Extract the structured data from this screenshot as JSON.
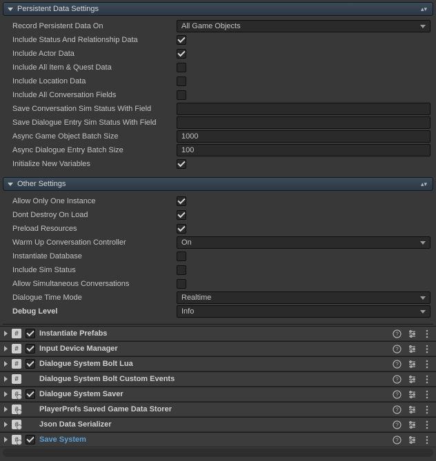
{
  "section1": {
    "title": "Persistent Data Settings",
    "rows": {
      "record_on": {
        "label": "Record Persistent Data On",
        "dropdown": "All Game Objects"
      },
      "inc_status_rel": {
        "label": "Include Status And Relationship Data",
        "checked": true
      },
      "inc_actor": {
        "label": "Include Actor Data",
        "checked": true
      },
      "inc_item_quest": {
        "label": "Include All Item & Quest Data",
        "checked": false
      },
      "inc_location": {
        "label": "Include Location Data",
        "checked": false
      },
      "inc_conv_fields": {
        "label": "Include All Conversation Fields",
        "checked": false
      },
      "save_conv_sim": {
        "label": "Save Conversation Sim Status With Field",
        "value": ""
      },
      "save_de_sim": {
        "label": "Save Dialogue Entry Sim Status With Field",
        "value": ""
      },
      "async_go_batch": {
        "label": "Async Game Object Batch Size",
        "value": "1000"
      },
      "async_de_batch": {
        "label": "Async Dialogue Entry Batch Size",
        "value": "100"
      },
      "init_new_vars": {
        "label": "Initialize New Variables",
        "checked": true
      }
    }
  },
  "section2": {
    "title": "Other Settings",
    "rows": {
      "one_instance": {
        "label": "Allow Only One Instance",
        "checked": true
      },
      "ddol": {
        "label": "Dont Destroy On Load",
        "checked": true
      },
      "preload": {
        "label": "Preload Resources",
        "checked": true
      },
      "warmup": {
        "label": "Warm Up Conversation Controller",
        "dropdown": "On"
      },
      "inst_db": {
        "label": "Instantiate Database",
        "checked": false
      },
      "inc_sim": {
        "label": "Include Sim Status",
        "checked": false
      },
      "allow_simul": {
        "label": "Allow Simultaneous Conversations",
        "checked": false
      },
      "time_mode": {
        "label": "Dialogue Time Mode",
        "dropdown": "Realtime"
      },
      "debug_level": {
        "label": "Debug Level",
        "dropdown": "Info"
      }
    }
  },
  "components": [
    {
      "name": "Instantiate Prefabs",
      "enabled": true,
      "icon": "script",
      "selected": false
    },
    {
      "name": "Input Device Manager",
      "enabled": true,
      "icon": "script",
      "selected": false
    },
    {
      "name": "Dialogue System Bolt Lua",
      "enabled": true,
      "icon": "script",
      "selected": false
    },
    {
      "name": "Dialogue System Bolt Custom Events",
      "enabled": null,
      "icon": "script",
      "selected": false
    },
    {
      "name": "Dialogue System Saver",
      "enabled": true,
      "icon": "gear",
      "selected": false
    },
    {
      "name": "PlayerPrefs Saved Game Data Storer",
      "enabled": null,
      "icon": "gear",
      "selected": false
    },
    {
      "name": "Json Data Serializer",
      "enabled": null,
      "icon": "gear",
      "selected": false
    },
    {
      "name": "Save System",
      "enabled": true,
      "icon": "gear",
      "selected": true
    }
  ]
}
